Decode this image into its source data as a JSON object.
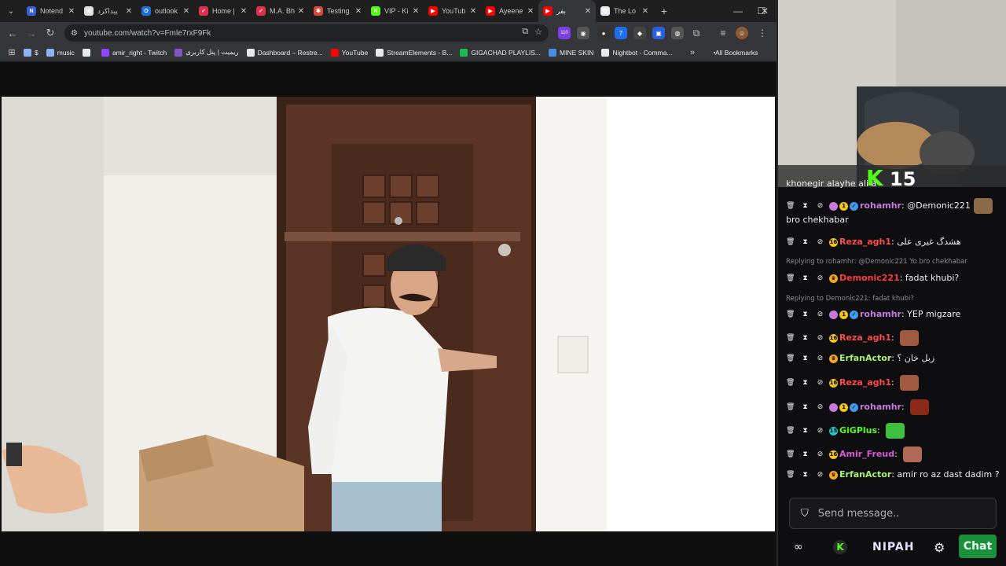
{
  "tabs": [
    {
      "label": "Notend",
      "fav_color": "#3b5fd9",
      "fav_glyph": "N"
    },
    {
      "label": "پیداکرد",
      "fav_color": "#e0e0e0",
      "fav_glyph": "◎"
    },
    {
      "label": "outlook",
      "fav_color": "#1c6fd6",
      "fav_glyph": "O"
    },
    {
      "label": "Home |",
      "fav_color": "#e0304a",
      "fav_glyph": "✓"
    },
    {
      "label": "M.A. Bh",
      "fav_color": "#e0304a",
      "fav_glyph": "✓"
    },
    {
      "label": "Testing",
      "fav_color": "#d94a3b",
      "fav_glyph": "✱"
    },
    {
      "label": "VIP - Ki",
      "fav_color": "#53fc18",
      "fav_glyph": "K"
    },
    {
      "label": "YouTub",
      "fav_color": "#ff0000",
      "fav_glyph": "▶"
    },
    {
      "label": "Ayeene",
      "fav_color": "#ff0000",
      "fav_glyph": "▶"
    },
    {
      "label": "بفر",
      "fav_color": "#ff0000",
      "fav_glyph": "▶",
      "active": true
    },
    {
      "label": "The Lo",
      "fav_color": "#e8eaed",
      "fav_glyph": "G"
    }
  ],
  "address_url": "youtube.com/watch?v=Fmle7rxF9Fk",
  "extension_badge": "110",
  "bookmarks": [
    {
      "label": "$",
      "color": "#8ab4f8"
    },
    {
      "label": "music",
      "color": "#8ab4f8"
    },
    {
      "label": "",
      "color": "#e8eaed"
    },
    {
      "label": "amir_right - Twitch",
      "color": "#9146ff"
    },
    {
      "label": "ریمیت | پنل کاربری",
      "color": "#7e57c2"
    },
    {
      "label": "Dashboard – Restre...",
      "color": "#e8eaed"
    },
    {
      "label": "YouTube",
      "color": "#ff0000"
    },
    {
      "label": "StreamElements - B...",
      "color": "#e8eaed"
    },
    {
      "label": "GIGACHAD PLAYLIS...",
      "color": "#1db954"
    },
    {
      "label": "MINE SKIN",
      "color": "#4a90e2"
    },
    {
      "label": "Nightbot - Comma...",
      "color": "#e8eaed"
    }
  ],
  "all_bookmarks_label": "All Bookmarks",
  "stream_overlay": {
    "kick_glyph": "K",
    "count": "15"
  },
  "chat": {
    "partial_top": "khonegir alayhe ali a",
    "messages": [
      {
        "badges": [
          "#c678dd",
          "#f5c518",
          "#3d9be9"
        ],
        "badge_glyphs": [
          "",
          "1",
          "✓"
        ],
        "user": "rohamhr",
        "user_color": "#c678dd",
        "text": "@Demonic221",
        "text2": "bro chekhabar",
        "emote": "#8b6a4a"
      },
      {
        "badges": [
          "#f5c518"
        ],
        "badge_glyphs": [
          "16"
        ],
        "user": "Reza_agh1",
        "user_color": "#ff4a4a",
        "text": "هشدگ غیری علی",
        "emote": ""
      },
      {
        "reply": "Replying to rohamhr: @Demonic221 Yo bro chekhabar"
      },
      {
        "badges": [
          "#f5a623"
        ],
        "badge_glyphs": [
          "♛"
        ],
        "user": "Demonic221",
        "user_color": "#ff3a3a",
        "text": "fadat khubi?",
        "emote": ""
      },
      {
        "reply": "Replying to Demonic221: fadat khubi?"
      },
      {
        "badges": [
          "#c678dd",
          "#f5c518",
          "#3d9be9"
        ],
        "badge_glyphs": [
          "",
          "1",
          "✓"
        ],
        "user": "rohamhr",
        "user_color": "#c678dd",
        "text": "YEP migzare",
        "emote": ""
      },
      {
        "badges": [
          "#f5c518"
        ],
        "badge_glyphs": [
          "16"
        ],
        "user": "Reza_agh1",
        "user_color": "#ff4a4a",
        "text": "",
        "emote": "#a05a40"
      },
      {
        "badges": [
          "#f5a623"
        ],
        "badge_glyphs": [
          "♛"
        ],
        "user": "ErfanActor",
        "user_color": "#a9f26b",
        "text": "زبل خان ؟",
        "emote": ""
      },
      {
        "badges": [
          "#f5c518"
        ],
        "badge_glyphs": [
          "16"
        ],
        "user": "Reza_agh1",
        "user_color": "#ff4a4a",
        "text": "",
        "emote": "#a05a40"
      },
      {
        "badges": [
          "#c678dd",
          "#f5c518",
          "#3d9be9"
        ],
        "badge_glyphs": [
          "",
          "1",
          "✓"
        ],
        "user": "rohamhr",
        "user_color": "#c678dd",
        "text": "",
        "emote": "#8a2a1a"
      },
      {
        "badges": [
          "#1fc8c8"
        ],
        "badge_glyphs": [
          "15"
        ],
        "user": "GiGPlus",
        "user_color": "#53fc18",
        "text": "",
        "emote": "#3fbf3f"
      },
      {
        "badges": [
          "#f5c518"
        ],
        "badge_glyphs": [
          "16"
        ],
        "user": "Amir_Freud",
        "user_color": "#d65ad6",
        "text": "",
        "emote": "#b06a55"
      },
      {
        "badges": [
          "#f5a623"
        ],
        "badge_glyphs": [
          "♛"
        ],
        "user": "ErfanActor",
        "user_color": "#a9f26b",
        "text": "amir ro az dast dadim ?",
        "emote": ""
      }
    ],
    "composer_placeholder": "Send message..",
    "brand_label": "NIPAH",
    "send_label": "Chat"
  }
}
